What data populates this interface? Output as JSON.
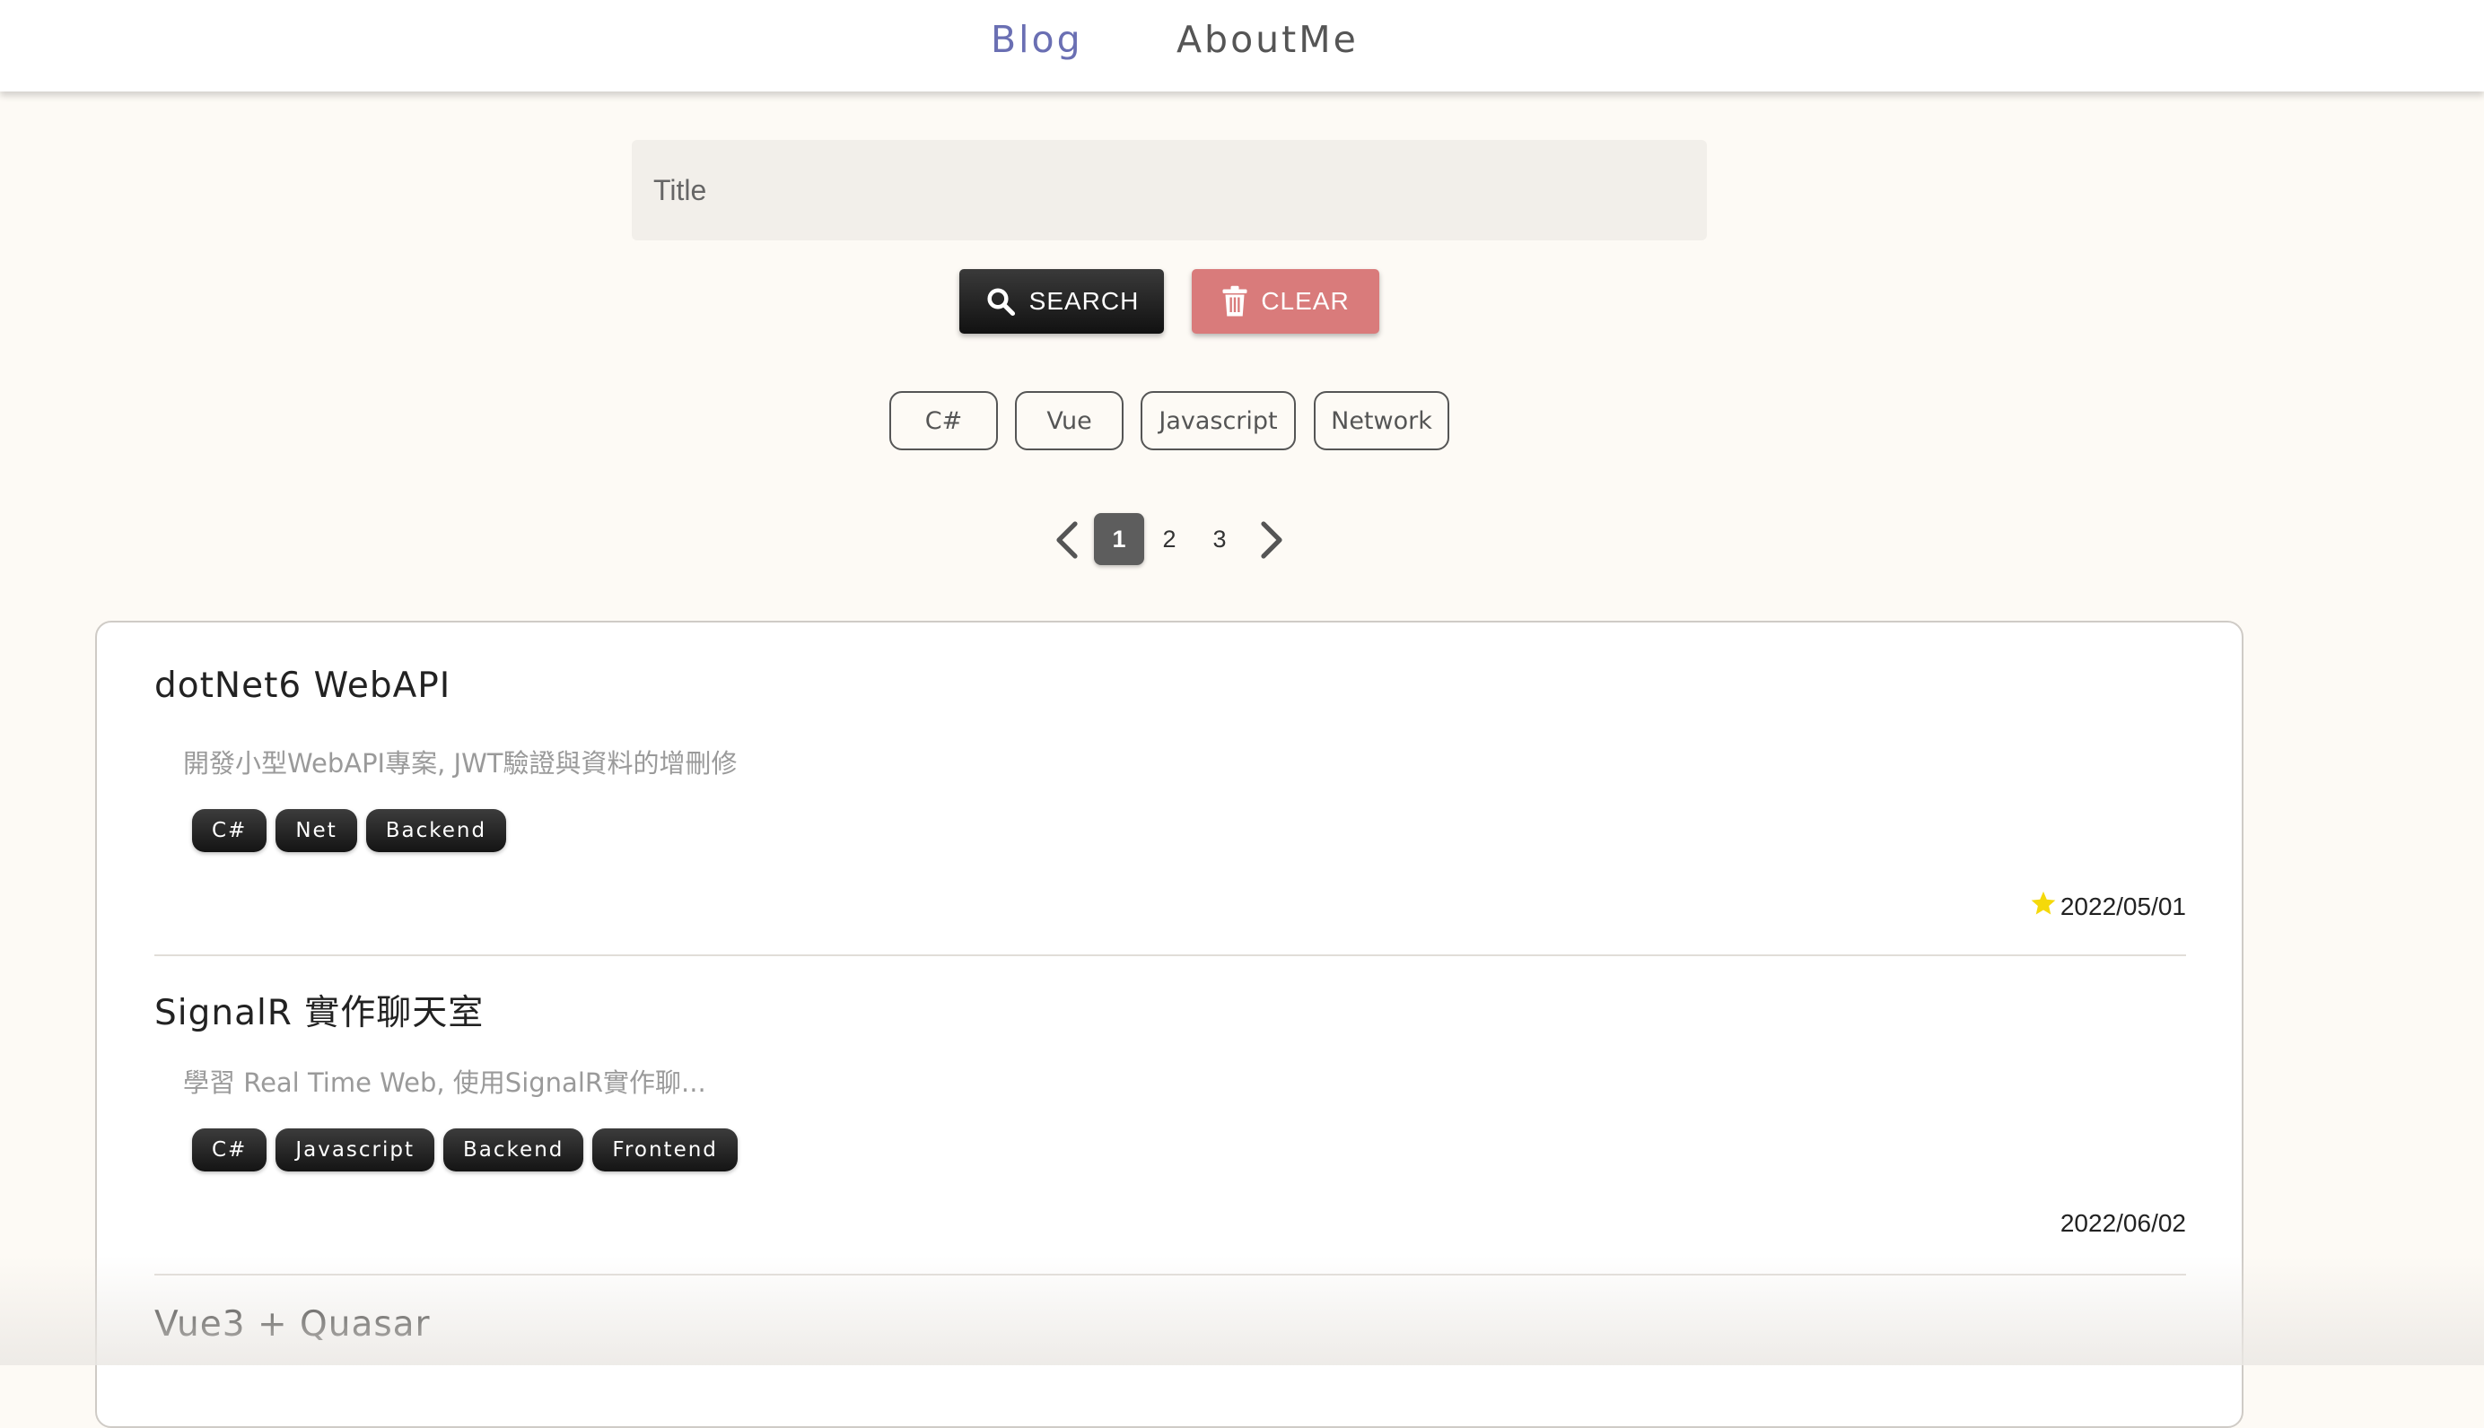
{
  "nav": {
    "blog_label": "Blog",
    "about_label": "AboutMe"
  },
  "search": {
    "placeholder": "Title",
    "value": "",
    "search_label": "SEARCH",
    "clear_label": "CLEAR"
  },
  "filters": [
    "C#",
    "Vue",
    "Javascript",
    "Network"
  ],
  "pagination": {
    "pages": [
      "1",
      "2",
      "3"
    ],
    "current": "1"
  },
  "posts": [
    {
      "title": "dotNet6 WebAPI",
      "description": "開發小型WebAPI專案, JWT驗證與資料的增刪修",
      "tags": [
        "C#",
        "Net",
        "Backend"
      ],
      "date": "2022/05/01",
      "starred": true
    },
    {
      "title": "SignalR 實作聊天室",
      "description": "學習 Real Time Web, 使用SignalR實作聊...",
      "tags": [
        "C#",
        "Javascript",
        "Backend",
        "Frontend"
      ],
      "date": "2022/06/02",
      "starred": false
    },
    {
      "title": "Vue3 + Quasar"
    }
  ],
  "colors": {
    "accent": "#6a6fb3",
    "clear_button": "#d97b7b",
    "star": "#f5d90a",
    "background": "#fdfaf5"
  },
  "icons": {
    "search": "search-icon",
    "clear": "trash-icon",
    "prev": "chevron-left-icon",
    "next": "chevron-right-icon",
    "star": "star-icon"
  }
}
